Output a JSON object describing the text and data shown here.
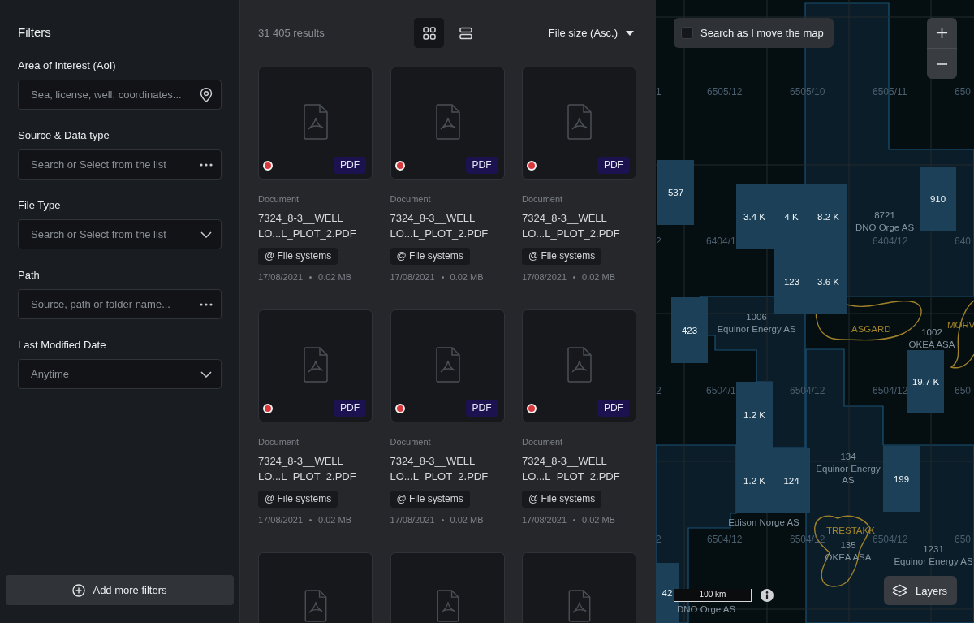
{
  "filters_panel": {
    "title": "Filters",
    "filters": [
      {
        "label": "Area of Interest (AoI)",
        "placeholder": "Sea, license, well, coordinates...",
        "kind": "location"
      },
      {
        "label": "Source & Data type",
        "placeholder": "Search or Select from the list",
        "kind": "more"
      },
      {
        "label": "File Type",
        "placeholder": "Search or Select from the list",
        "kind": "dropdown"
      },
      {
        "label": "Path",
        "placeholder": "Source, path or folder name...",
        "kind": "more"
      },
      {
        "label": "Last Modified Date",
        "placeholder": "Anytime",
        "kind": "dropdown"
      }
    ],
    "add_button": {
      "label": "Add more filters"
    }
  },
  "results": {
    "count": "31 405 results",
    "views": [
      {
        "kind": "grid",
        "selected": true
      },
      {
        "kind": "list",
        "selected": false
      }
    ],
    "sort": {
      "label": "File size (Asc.)"
    },
    "cards": [
      {
        "kind": "pdf",
        "color": "#d8383c",
        "badge": "PDF",
        "category": "Document",
        "name": "7324_8-3__WELL LO...L_PLOT_2.PDF",
        "source": "@ File systems",
        "date": "17/08/2021",
        "size": "0.02 MB"
      },
      {
        "kind": "pdf",
        "color": "#d8383c",
        "badge": "PDF",
        "category": "Document",
        "name": "7324_8-3__WELL LO...L_PLOT_2.PDF",
        "source": "@ File systems",
        "date": "17/08/2021",
        "size": "0.02 MB"
      },
      {
        "kind": "pdf",
        "color": "#d8383c",
        "badge": "PDF",
        "category": "Document",
        "name": "7324_8-3__WELL LO...L_PLOT_2.PDF",
        "source": "@ File systems",
        "date": "17/08/2021",
        "size": "0.02 MB"
      },
      {
        "kind": "pdf",
        "color": "#d8383c",
        "badge": "PDF",
        "category": "Document",
        "name": "7324_8-3__WELL LO...L_PLOT_2.PDF",
        "source": "@ File systems",
        "date": "17/08/2021",
        "size": "0.02 MB"
      },
      {
        "kind": "pdf",
        "color": "#d8383c",
        "badge": "PDF",
        "category": "Document",
        "name": "7324_8-3__WELL LO...L_PLOT_2.PDF",
        "source": "@ File systems",
        "date": "17/08/2021",
        "size": "0.02 MB"
      },
      {
        "kind": "pdf",
        "color": "#d8383c",
        "badge": "PDF",
        "category": "Document",
        "name": "7324_8-3__WELL LO...L_PLOT_2.PDF",
        "source": "@ File systems",
        "date": "17/08/2021",
        "size": "0.02 MB"
      },
      {
        "kind": "pdf"
      },
      {
        "kind": "pdf"
      },
      {
        "kind": "pdf"
      }
    ]
  },
  "map": {
    "search_toggle": {
      "label": "Search as I move the map",
      "checked": false
    },
    "grid_labels": [
      "1",
      "6505/12",
      "6505/10",
      "6505/11",
      "650",
      "2",
      "6404/1",
      "6404/12",
      "640",
      "2",
      "6504/1",
      "6504/12",
      "6504/12",
      "650",
      "2",
      "6504/12",
      "6504/12",
      "6504/12",
      "650"
    ],
    "clusters": [
      "537",
      "3.4 K",
      "4 K",
      "8.2 K",
      "910",
      "123",
      "3.6 K",
      "423",
      "19.7 K",
      "1.2 K",
      "1.2 K",
      "124",
      "199",
      "42"
    ],
    "licenses": [
      {
        "number": "8721",
        "operator": "DNO Orge AS"
      },
      {
        "number": "1006",
        "operator": "Equinor Energy AS"
      },
      {
        "number": "1002",
        "operator": "OKEA ASA"
      },
      {
        "number": "134",
        "operator": "Equinor Energy AS"
      },
      {
        "operator": "Edison Norge AS"
      },
      {
        "number": "135",
        "operator": "OKEA ASA"
      },
      {
        "number": "1231",
        "operator": "Equinor Energy AS"
      },
      {
        "operator": "DNO Orge AS"
      }
    ],
    "fields": [
      "ASGARD",
      "MORV",
      "TRESTAKK"
    ],
    "scale": {
      "label": "100 km"
    },
    "layers_button": {
      "label": "Layers"
    }
  }
}
